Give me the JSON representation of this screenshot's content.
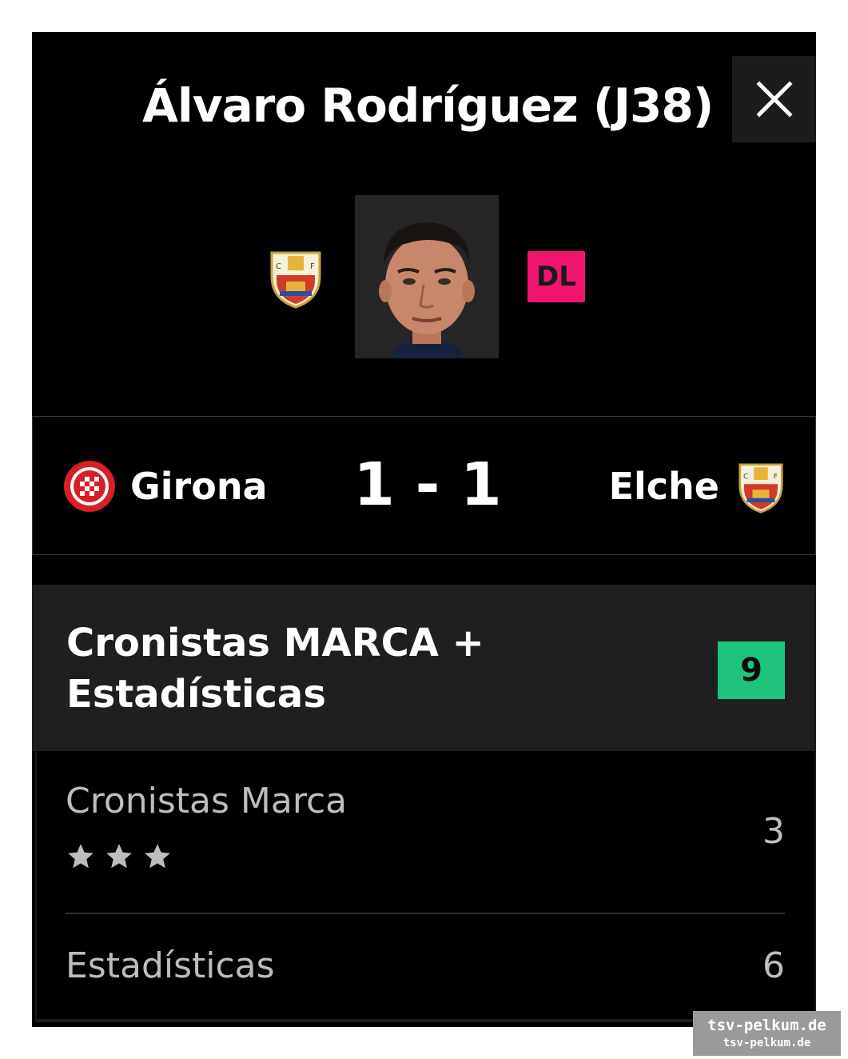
{
  "header": {
    "title": "Álvaro Rodríguez (J38)",
    "close_icon": "close-icon"
  },
  "player": {
    "photo_icon": "player-photo",
    "team_crest_icon": "elche-crest-icon",
    "position": "DL",
    "position_color": "#f0146e"
  },
  "match": {
    "home_team": "Girona",
    "home_crest_icon": "girona-crest-icon",
    "score": "1 - 1",
    "away_team": "Elche",
    "away_crest_icon": "elche-crest-icon"
  },
  "rating": {
    "title": "Cronistas MARCA + Estadísticas",
    "total": "9",
    "total_color": "#1ec47c",
    "rows": [
      {
        "label": "Cronistas Marca",
        "value": "3",
        "stars": 3
      },
      {
        "label": "Estadísticas",
        "value": "6"
      }
    ]
  },
  "watermark": {
    "line1": "tsv-pelkum.de",
    "line2": "tsv-pelkum.de"
  }
}
